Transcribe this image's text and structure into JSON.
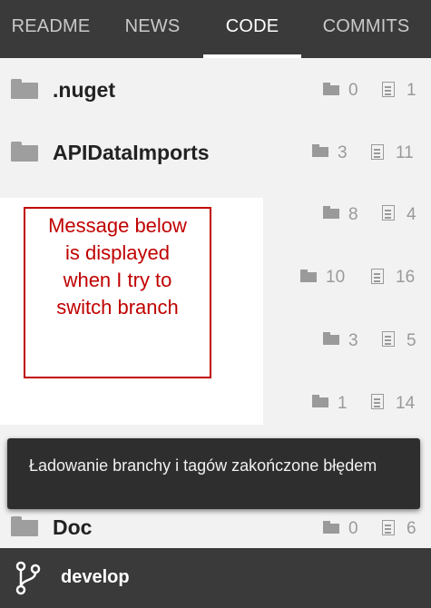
{
  "tabs": [
    {
      "label": "README"
    },
    {
      "label": "NEWS"
    },
    {
      "label": "CODE"
    },
    {
      "label": "COMMITS"
    }
  ],
  "active_tab": "CODE",
  "files": [
    {
      "name": ".nuget",
      "folders": "0",
      "files": "1"
    },
    {
      "name": "APIDataImports",
      "folders": "3",
      "files": "11"
    },
    {
      "name": "",
      "folders": "8",
      "files": "4"
    },
    {
      "name": "",
      "folders": "10",
      "files": "16"
    },
    {
      "name": "",
      "folders": "3",
      "files": "5"
    },
    {
      "name": "",
      "folders": "1",
      "files": "14"
    },
    {
      "name": "Doc",
      "folders": "0",
      "files": "6"
    }
  ],
  "annotation": {
    "line1": "Message below",
    "line2": "is displayed",
    "line3": "when I try to",
    "line4": "switch branch"
  },
  "toast": {
    "message": "Ładowanie branchy i tagów zakończone błędem"
  },
  "branch": {
    "icon": "git-branch-icon",
    "name": "develop"
  },
  "colors": {
    "bar": "#3a3a3a",
    "annotation": "#c00000",
    "toast": "#2e2e2e"
  }
}
